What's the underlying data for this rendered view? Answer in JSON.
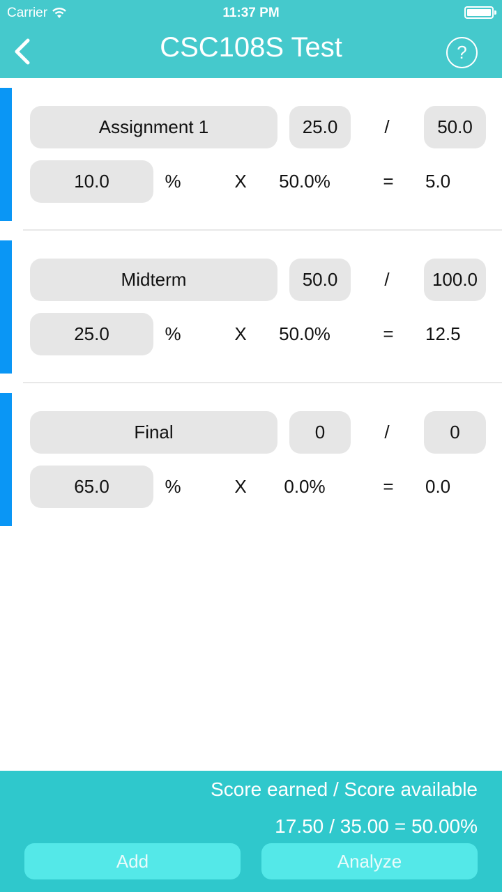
{
  "status_bar": {
    "carrier": "Carrier",
    "time": "11:37 PM"
  },
  "header": {
    "title": "CSC108S Test",
    "help_label": "?"
  },
  "items": [
    {
      "name": "Assignment 1",
      "earned": "25.0",
      "total": "50.0",
      "weight": "10.0",
      "percent_sign": "%",
      "times": "X",
      "ratio": "50.0%",
      "equals": "=",
      "result": "5.0",
      "slash": "/"
    },
    {
      "name": "Midterm",
      "earned": "50.0",
      "total": "100.0",
      "weight": "25.0",
      "percent_sign": "%",
      "times": "X",
      "ratio": "50.0%",
      "equals": "=",
      "result": "12.5",
      "slash": "/"
    },
    {
      "name": "Final",
      "earned": "0",
      "total": "0",
      "weight": "65.0",
      "percent_sign": "%",
      "times": "X",
      "ratio": "0.0%",
      "equals": "=",
      "result": "0.0",
      "slash": "/"
    }
  ],
  "footer": {
    "summary_label": "Score earned / Score available",
    "earned": "17.50",
    "available": "/ 35.00",
    "percent": "= 50.00%",
    "add_label": "Add",
    "analyze_label": "Analyze"
  },
  "colors": {
    "header": "#45c9cc",
    "footer": "#2fc8cc",
    "accent_bar": "#0a96f5",
    "button": "#54e8e8",
    "field": "#e6e6e6"
  }
}
